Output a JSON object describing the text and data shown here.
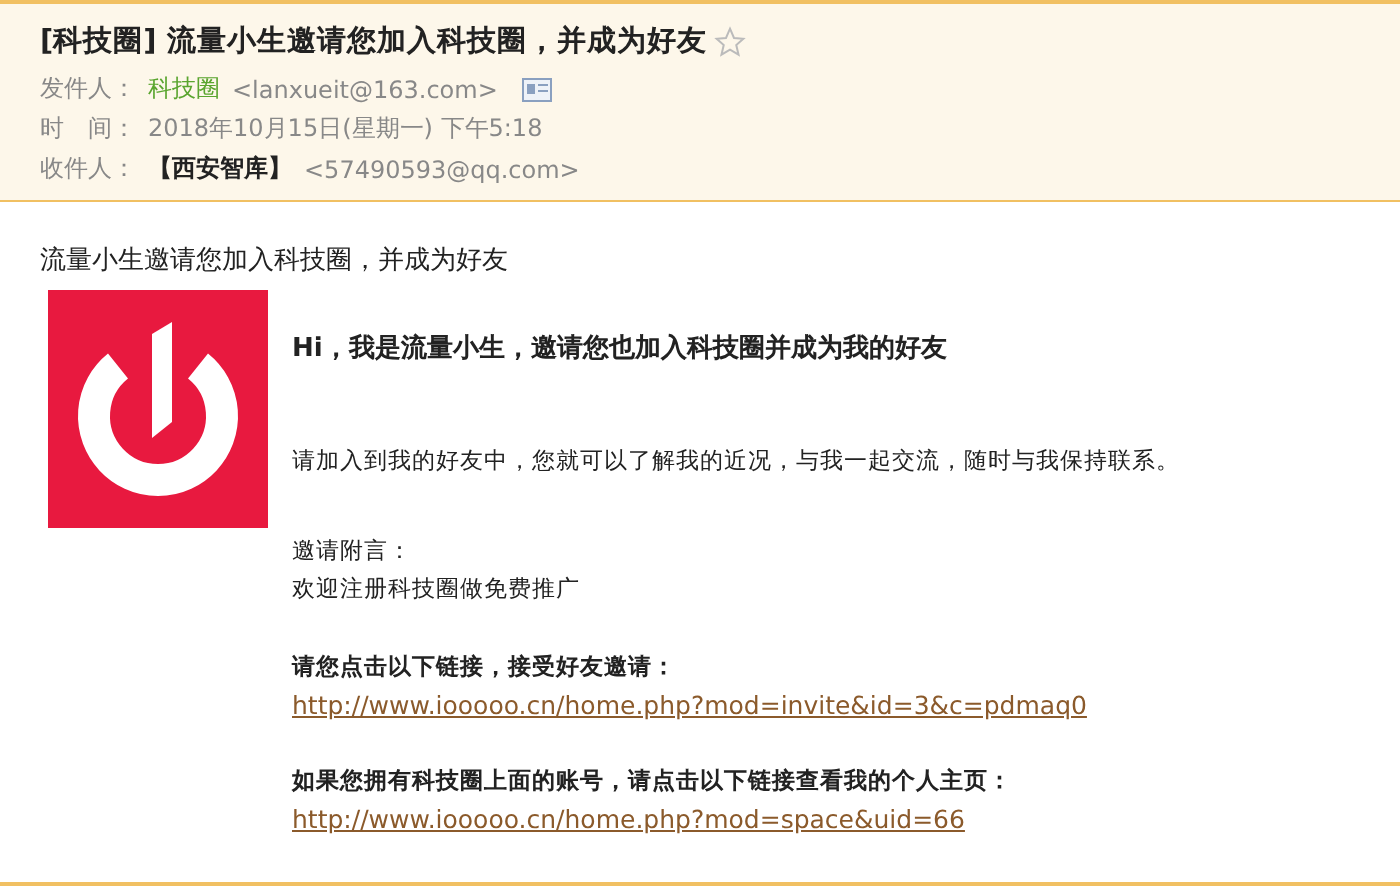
{
  "header": {
    "subject": "[科技圈] 流量小生邀请您加入科技圈，并成为好友",
    "starred": false,
    "sender_label": "发件人：",
    "sender_name": "科技圈",
    "sender_email": "<lanxueit@163.com>",
    "time_label": "时　间：",
    "time": "2018年10月15日(星期一) 下午5:18",
    "recipient_label": "收件人：",
    "recipient_name": "【西安智库】",
    "recipient_email": "<57490593@qq.com>"
  },
  "body": {
    "intro": "流量小生邀请您加入科技圈，并成为好友",
    "heading": "Hi，我是流量小生，邀请您也加入科技圈并成为我的好友",
    "message": "请加入到我的好友中，您就可以了解我的近况，与我一起交流，随时与我保持联系。",
    "note_label": "邀请附言：",
    "note": "欢迎注册科技圈做免费推广",
    "sections": [
      {
        "prompt": "请您点击以下链接，接受好友邀请：",
        "link": "http://www.iooooo.cn/home.php?mod=invite&id=3&c=pdmaq0"
      },
      {
        "prompt": "如果您拥有科技圈上面的账号，请点击以下链接查看我的个人主页：",
        "link": "http://www.iooooo.cn/home.php?mod=space&uid=66"
      }
    ]
  }
}
